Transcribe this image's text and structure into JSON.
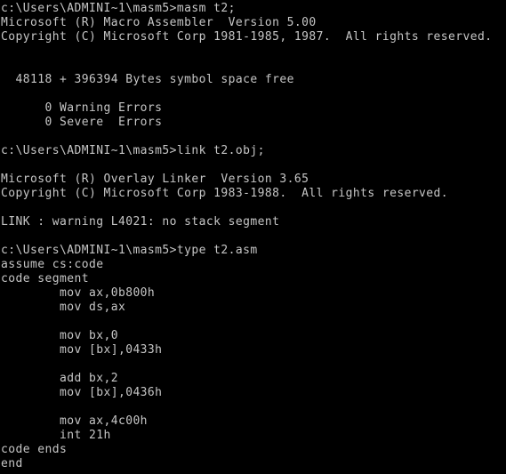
{
  "window": {
    "title": "Command Prompt",
    "background_color": "#000000",
    "text_color": "#c6c6c6",
    "columns": 70,
    "rows": 33
  },
  "terminal": {
    "prompt_path": "c:\\Users\\ADMINI~1\\masm5>",
    "lines": [
      {
        "id": "l0",
        "kind": "prompt",
        "text": "c:\\Users\\ADMINI~1\\masm5>masm t2;"
      },
      {
        "id": "l1",
        "kind": "output",
        "text": "Microsoft (R) Macro Assembler  Version 5.00"
      },
      {
        "id": "l2",
        "kind": "output",
        "text": "Copyright (C) Microsoft Corp 1981-1985, 1987.  All rights reserved."
      },
      {
        "id": "l3",
        "kind": "blank",
        "text": ""
      },
      {
        "id": "l4",
        "kind": "blank",
        "text": ""
      },
      {
        "id": "l5",
        "kind": "output",
        "text": "  48118 + 396394 Bytes symbol space free"
      },
      {
        "id": "l6",
        "kind": "blank",
        "text": ""
      },
      {
        "id": "l7",
        "kind": "output",
        "text": "      0 Warning Errors"
      },
      {
        "id": "l8",
        "kind": "output",
        "text": "      0 Severe  Errors"
      },
      {
        "id": "l9",
        "kind": "blank",
        "text": ""
      },
      {
        "id": "l10",
        "kind": "prompt",
        "text": "c:\\Users\\ADMINI~1\\masm5>link t2.obj;"
      },
      {
        "id": "l11",
        "kind": "blank",
        "text": ""
      },
      {
        "id": "l12",
        "kind": "output",
        "text": "Microsoft (R) Overlay Linker  Version 3.65"
      },
      {
        "id": "l13",
        "kind": "output",
        "text": "Copyright (C) Microsoft Corp 1983-1988.  All rights reserved."
      },
      {
        "id": "l14",
        "kind": "blank",
        "text": ""
      },
      {
        "id": "l15",
        "kind": "output",
        "text": "LINK : warning L4021: no stack segment"
      },
      {
        "id": "l16",
        "kind": "blank",
        "text": ""
      },
      {
        "id": "l17",
        "kind": "prompt",
        "text": "c:\\Users\\ADMINI~1\\masm5>type t2.asm"
      },
      {
        "id": "l18",
        "kind": "source",
        "text": "assume cs:code"
      },
      {
        "id": "l19",
        "kind": "source",
        "text": "code segment"
      },
      {
        "id": "l20",
        "kind": "source",
        "text": "        mov ax,0b800h"
      },
      {
        "id": "l21",
        "kind": "source",
        "text": "        mov ds,ax"
      },
      {
        "id": "l22",
        "kind": "blank",
        "text": ""
      },
      {
        "id": "l23",
        "kind": "source",
        "text": "        mov bx,0"
      },
      {
        "id": "l24",
        "kind": "source",
        "text": "        mov [bx],0433h"
      },
      {
        "id": "l25",
        "kind": "blank",
        "text": ""
      },
      {
        "id": "l26",
        "kind": "source",
        "text": "        add bx,2"
      },
      {
        "id": "l27",
        "kind": "source",
        "text": "        mov [bx],0436h"
      },
      {
        "id": "l28",
        "kind": "blank",
        "text": ""
      },
      {
        "id": "l29",
        "kind": "source",
        "text": "        mov ax,4c00h"
      },
      {
        "id": "l30",
        "kind": "source",
        "text": "        int 21h"
      },
      {
        "id": "l31",
        "kind": "source",
        "text": "code ends"
      },
      {
        "id": "l32",
        "kind": "source",
        "text": "end"
      }
    ]
  }
}
